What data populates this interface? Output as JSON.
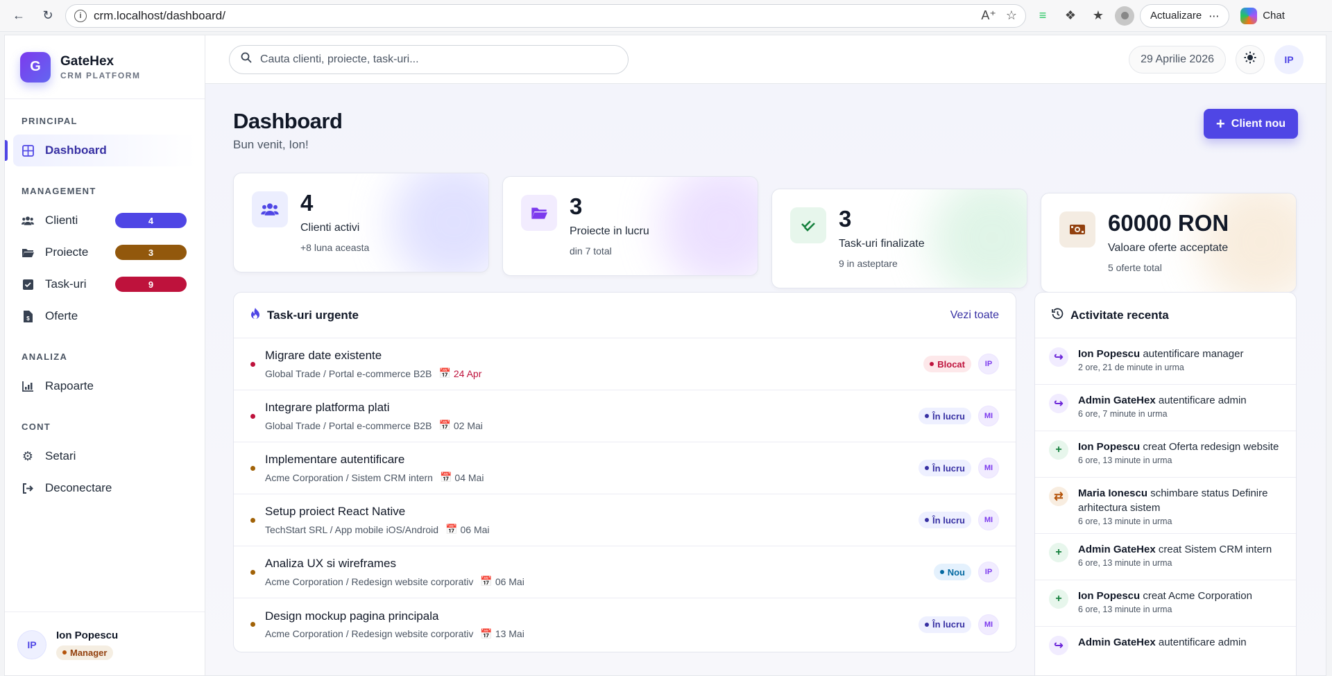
{
  "browser": {
    "url": "crm.localhost/dashboard/",
    "update_label": "Actualizare",
    "chat_label": "Chat"
  },
  "brand": {
    "letter": "G",
    "name": "GateHex",
    "subtitle": "CRM PLATFORM"
  },
  "sidebar": {
    "sections": {
      "principal": "PRINCIPAL",
      "management": "MANAGEMENT",
      "analiza": "ANALIZA",
      "cont": "CONT"
    },
    "items": {
      "dashboard": {
        "label": "Dashboard"
      },
      "clienti": {
        "label": "Clienti",
        "badge": "4",
        "color": "#4f46e5"
      },
      "proiecte": {
        "label": "Proiecte",
        "badge": "3",
        "color": "#92580c"
      },
      "taskuri": {
        "label": "Task-uri",
        "badge": "9",
        "color": "#be123c"
      },
      "oferte": {
        "label": "Oferte"
      },
      "rapoarte": {
        "label": "Rapoarte"
      },
      "setari": {
        "label": "Setari"
      },
      "deconectare": {
        "label": "Deconectare"
      }
    },
    "user": {
      "initials": "IP",
      "name": "Ion Popescu",
      "role": "Manager"
    }
  },
  "header": {
    "search_placeholder": "Cauta clienti, proiecte, task-uri...",
    "date": "29 Aprilie 2026",
    "user_initials": "IP"
  },
  "page": {
    "title": "Dashboard",
    "subtitle": "Bun venit, Ion!",
    "new_client_label": "Client nou"
  },
  "stats": [
    {
      "value": "4",
      "label": "Clienti activi",
      "sub": "+8 luna aceasta",
      "icon": "users-icon",
      "accent": "#4f46e5"
    },
    {
      "value": "3",
      "label": "Proiecte in lucru",
      "sub": "din 7 total",
      "icon": "folder-icon",
      "accent": "#7c3aed"
    },
    {
      "value": "3",
      "label": "Task-uri finalizate",
      "sub": "9 in asteptare",
      "icon": "check-icon",
      "accent": "#15803d"
    },
    {
      "value": "60000 RON",
      "label": "Valoare oferte acceptate",
      "sub": "5 oferte total",
      "icon": "money-icon",
      "accent": "#92400e"
    }
  ],
  "tasks_panel": {
    "title": "Task-uri urgente",
    "link": "Vezi toate",
    "rows": [
      {
        "title": "Migrare date existente",
        "meta": "Global Trade / Portal e-commerce B2B",
        "date": "24 Apr",
        "status": "Blocat",
        "assignee": "IP"
      },
      {
        "title": "Integrare platforma plati",
        "meta": "Global Trade / Portal e-commerce B2B",
        "date": "02 Mai",
        "status": "În lucru",
        "assignee": "MI"
      },
      {
        "title": "Implementare autentificare",
        "meta": "Acme Corporation / Sistem CRM intern",
        "date": "04 Mai",
        "status": "În lucru",
        "assignee": "MI"
      },
      {
        "title": "Setup proiect React Native",
        "meta": "TechStart SRL / App mobile iOS/Android",
        "date": "06 Mai",
        "status": "În lucru",
        "assignee": "MI"
      },
      {
        "title": "Analiza UX si wireframes",
        "meta": "Acme Corporation / Redesign website corporativ",
        "date": "06 Mai",
        "status": "Nou",
        "assignee": "IP"
      },
      {
        "title": "Design mockup pagina principala",
        "meta": "Acme Corporation / Redesign website corporativ",
        "date": "13 Mai",
        "status": "În lucru",
        "assignee": "MI"
      }
    ]
  },
  "activity_panel": {
    "title": "Activitate recenta",
    "rows": [
      {
        "user": "Ion Popescu",
        "action": "autentificare manager",
        "time": "2 ore, 21 de minute in urma",
        "kind": "login"
      },
      {
        "user": "Admin GateHex",
        "action": "autentificare admin",
        "time": "6 ore, 7 minute in urma",
        "kind": "login"
      },
      {
        "user": "Ion Popescu",
        "action": "creat Oferta redesign website",
        "time": "6 ore, 13 minute in urma",
        "kind": "create"
      },
      {
        "user": "Maria Ionescu",
        "action": "schimbare status Definire arhitectura sistem",
        "time": "6 ore, 13 minute in urma",
        "kind": "status"
      },
      {
        "user": "Admin GateHex",
        "action": "creat Sistem CRM intern",
        "time": "6 ore, 13 minute in urma",
        "kind": "create"
      },
      {
        "user": "Ion Popescu",
        "action": "creat Acme Corporation",
        "time": "6 ore, 13 minute in urma",
        "kind": "create"
      },
      {
        "user": "Admin GateHex",
        "action": "autentificare admin",
        "time": "",
        "kind": "login"
      }
    ]
  }
}
